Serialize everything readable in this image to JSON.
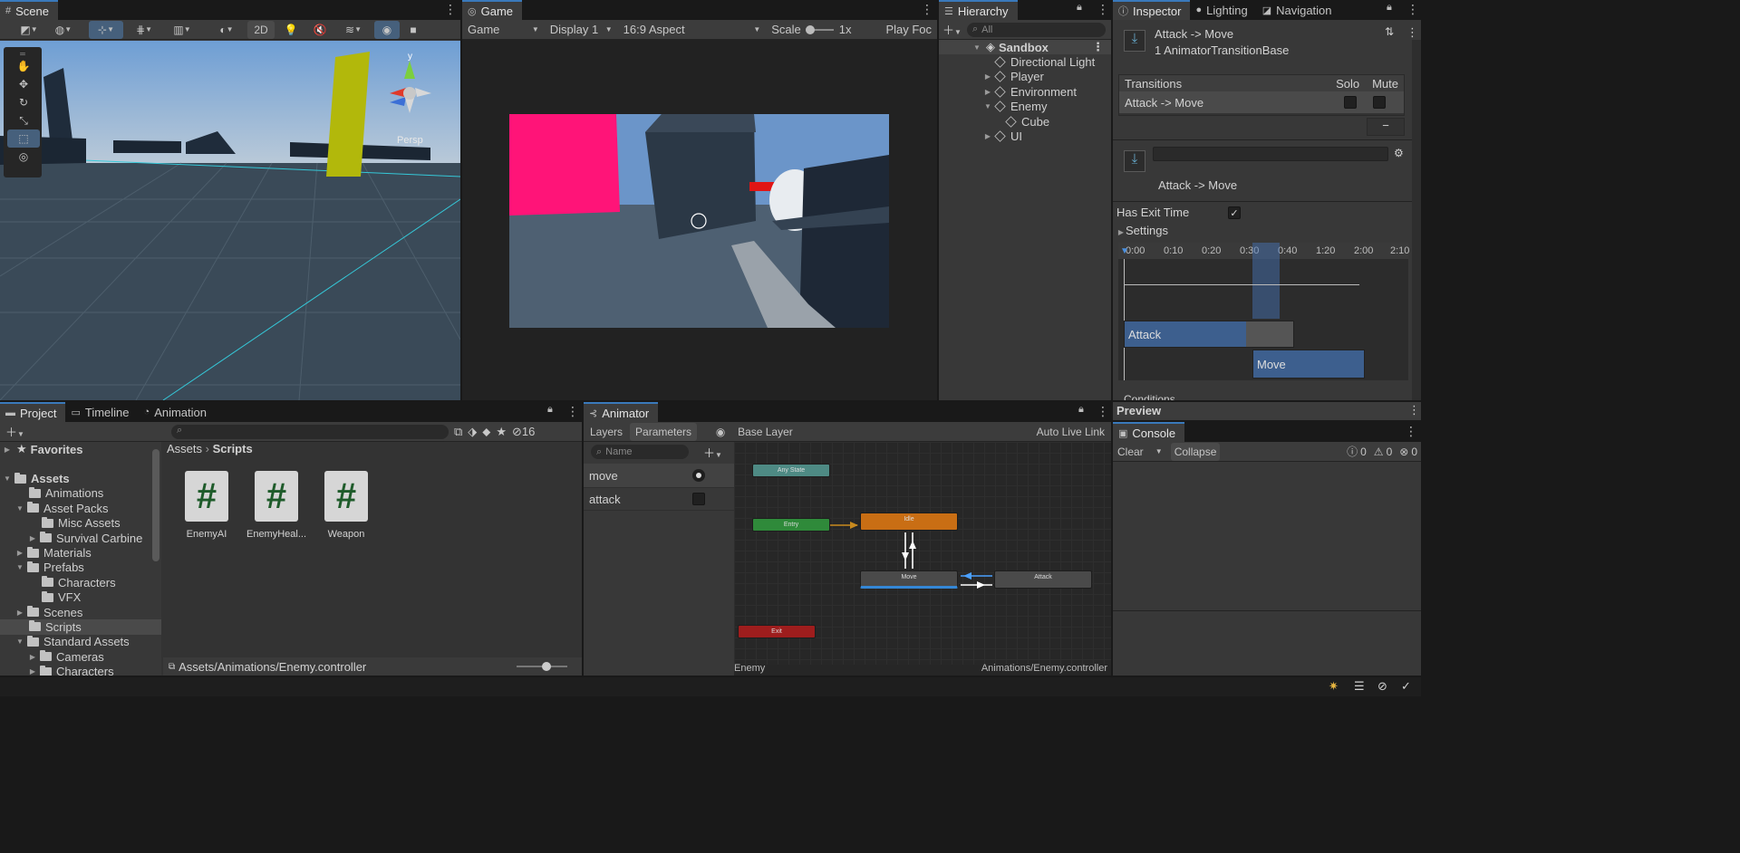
{
  "scene": {
    "tab": "Scene",
    "btn_2d": "2D",
    "gizmo_y": "y",
    "persp": "Persp"
  },
  "game": {
    "tab": "Game",
    "mode": "Game",
    "display": "Display 1",
    "aspect": "16:9 Aspect",
    "scale_label": "Scale",
    "scale_value": "1x",
    "play_focused": "Play Foc"
  },
  "hierarchy": {
    "tab": "Hierarchy",
    "search_placeholder": "All",
    "items": [
      {
        "label": "Sandbox"
      },
      {
        "label": "Directional Light"
      },
      {
        "label": "Player"
      },
      {
        "label": "Environment"
      },
      {
        "label": "Enemy"
      },
      {
        "label": "Cube"
      },
      {
        "label": "UI"
      }
    ]
  },
  "inspector": {
    "tabs": [
      "Inspector",
      "Lighting",
      "Navigation"
    ],
    "title": "Attack -> Move",
    "subtitle": "1 AnimatorTransitionBase",
    "transitions_header": "Transitions",
    "solo": "Solo",
    "mute": "Mute",
    "transition_item": "Attack -> Move",
    "minus": "−",
    "transition_name": "Attack -> Move",
    "has_exit_time": "Has Exit Time",
    "settings": "Settings",
    "ticks": [
      "0:00",
      "0:10",
      "0:20",
      "0:30",
      "0:40",
      "1:20",
      "2:00",
      "2:10"
    ],
    "clip_attack": "Attack",
    "clip_move": "Move",
    "conditions": "Conditions",
    "preview": "Preview"
  },
  "project": {
    "tabs": [
      "Project",
      "Timeline",
      "Animation"
    ],
    "hidden_count": "16",
    "favorites": "Favorites",
    "tree": [
      {
        "label": "Assets"
      },
      {
        "label": "Animations"
      },
      {
        "label": "Asset Packs"
      },
      {
        "label": "Misc Assets"
      },
      {
        "label": "Survival Carbine"
      },
      {
        "label": "Materials"
      },
      {
        "label": "Prefabs"
      },
      {
        "label": "Characters"
      },
      {
        "label": "VFX"
      },
      {
        "label": "Scenes"
      },
      {
        "label": "Scripts"
      },
      {
        "label": "Standard Assets"
      },
      {
        "label": "Cameras"
      },
      {
        "label": "Characters"
      }
    ],
    "breadcrumb": [
      "Assets",
      "Scripts"
    ],
    "files": [
      {
        "name": "EnemyAI"
      },
      {
        "name": "EnemyHeal..."
      },
      {
        "name": "Weapon"
      }
    ],
    "footer_path": "Assets/Animations/Enemy.controller"
  },
  "animator": {
    "tab": "Animator",
    "layers": "Layers",
    "parameters": "Parameters",
    "layer": "Base Layer",
    "auto_live_link": "Auto Live Link",
    "name_placeholder": "Name",
    "params": [
      {
        "name": "move"
      },
      {
        "name": "attack"
      }
    ],
    "nodes": {
      "any_state": "Any State",
      "entry": "Entry",
      "idle": "Idle",
      "move": "Move",
      "attack": "Attack",
      "exit": "Exit"
    },
    "footer_left": "Enemy",
    "footer_right": "Animations/Enemy.controller"
  },
  "console": {
    "tab": "Console",
    "clear": "Clear",
    "collapse": "Collapse",
    "counts": [
      "0",
      "0",
      "0"
    ]
  }
}
